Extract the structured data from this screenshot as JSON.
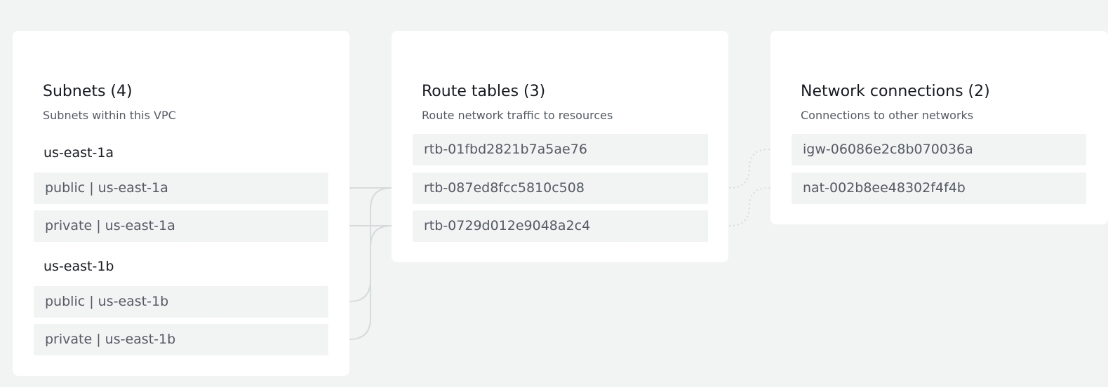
{
  "subnets_panel": {
    "title": "Subnets (4)",
    "subtitle": "Subnets within this VPC",
    "zones": [
      {
        "label": "us-east-1a",
        "subnets": [
          "public | us-east-1a",
          "private | us-east-1a"
        ]
      },
      {
        "label": "us-east-1b",
        "subnets": [
          "public | us-east-1b",
          "private | us-east-1b"
        ]
      }
    ]
  },
  "route_tables_panel": {
    "title": "Route tables (3)",
    "subtitle": "Route network traffic to resources",
    "items": [
      "rtb-01fbd2821b7a5ae76",
      "rtb-087ed8fcc5810c508",
      "rtb-0729d012e9048a2c4"
    ]
  },
  "connections_panel": {
    "title": "Network connections (2)",
    "subtitle": "Connections to other networks",
    "items": [
      "igw-06086e2c8b070036a",
      "nat-002b8ee48302f4f4b"
    ]
  },
  "colors": {
    "page_background": "#f2f3f3",
    "panel_background": "#ffffff",
    "item_background": "#f2f3f3",
    "connector_solid": "#d5dbdb",
    "connector_dotted": "#d5dbdb"
  }
}
